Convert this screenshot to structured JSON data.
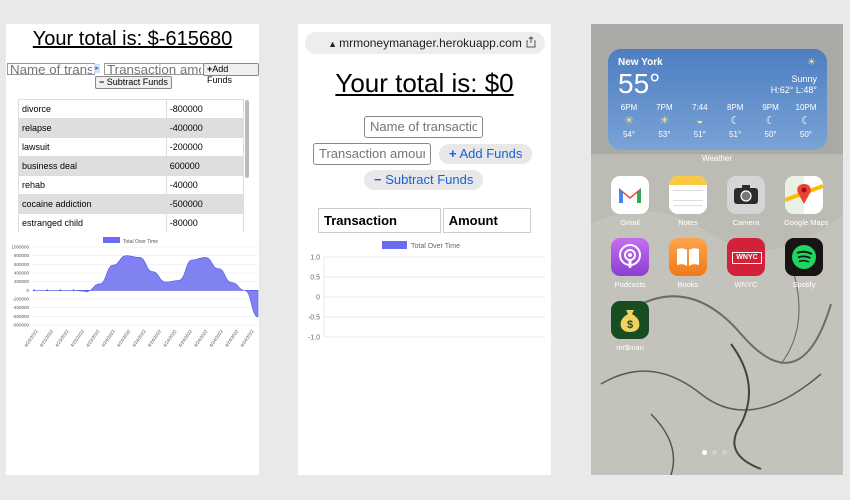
{
  "panel1": {
    "total": "Your total is: $-615680",
    "name_placeholder": "Name of transaction",
    "amount_placeholder": "Transaction amount",
    "add_label": "Add Funds",
    "subtract_label": "Subtract Funds",
    "transactions": [
      {
        "name": "divorce",
        "amount": "-800000"
      },
      {
        "name": "relapse",
        "amount": "-400000"
      },
      {
        "name": "lawsuit",
        "amount": "-200000"
      },
      {
        "name": "business deal",
        "amount": "600000"
      },
      {
        "name": "rehab",
        "amount": "-40000"
      },
      {
        "name": "cocaine addiction",
        "amount": "-500000"
      },
      {
        "name": "estranged child",
        "amount": "-80000"
      }
    ]
  },
  "panel2": {
    "url": "mrmoneymanager.herokuapp.com",
    "total": "Your total is: $0",
    "name_placeholder": "Name of transaction",
    "amount_placeholder": "Transaction amount",
    "add_label": "Add Funds",
    "subtract_label": "Subtract Funds",
    "col_transaction": "Transaction",
    "col_amount": "Amount"
  },
  "chart_data": [
    {
      "type": "area",
      "legend": "Total Over Time",
      "legend_color": "#6a6cf0",
      "x": [
        "4/23/2022",
        "4/23/2022",
        "4/23/2022",
        "4/23/2022",
        "4/23/2022",
        "4/24/2022",
        "4/24/2022",
        "4/24/2022",
        "4/24/2022",
        "4/24/2022",
        "4/24/2022",
        "4/24/2022",
        "4/24/2022",
        "4/24/2022",
        "4/24/2022"
      ],
      "y": [
        0,
        0,
        0,
        0,
        -25000,
        150000,
        580000,
        800000,
        760000,
        430000,
        190000,
        230000,
        700000,
        760000,
        500000,
        180000,
        0,
        -615680
      ],
      "ylim": [
        -800000,
        1000000
      ],
      "yticks": [
        "1000000",
        "800000",
        "600000",
        "400000",
        "200000",
        "0",
        "-200000",
        "-400000",
        "-600000",
        "-800000"
      ]
    },
    {
      "type": "line",
      "legend": "Total Over Time",
      "legend_color": "#6a6cf0",
      "x": [],
      "y": [],
      "ylim": [
        -1.0,
        1.0
      ],
      "yticks": [
        "1.0",
        "0.5",
        "0",
        "-0.5",
        "-1.0"
      ]
    }
  ],
  "phone": {
    "weather": {
      "city": "New York",
      "temp": "55°",
      "condition": "Sunny",
      "hilo": "H:62° L:48°",
      "hours": [
        {
          "time": "6PM",
          "temp": "54°",
          "icon": "sun-icon"
        },
        {
          "time": "7PM",
          "temp": "53°",
          "icon": "sun-icon"
        },
        {
          "time": "7:44",
          "temp": "51°",
          "icon": "sunset-icon"
        },
        {
          "time": "8PM",
          "temp": "51°",
          "icon": "moon-icon"
        },
        {
          "time": "9PM",
          "temp": "50°",
          "icon": "moon-icon"
        },
        {
          "time": "10PM",
          "temp": "50°",
          "icon": "moon-icon"
        }
      ],
      "widget_label": "Weather"
    },
    "apps": [
      {
        "name": "Gmail",
        "icon": "gmail-icon"
      },
      {
        "name": "Notes",
        "icon": "notes-icon"
      },
      {
        "name": "Camera",
        "icon": "camera-icon"
      },
      {
        "name": "Google Maps",
        "icon": "google-maps-icon"
      },
      {
        "name": "Podcasts",
        "icon": "podcasts-icon"
      },
      {
        "name": "Books",
        "icon": "books-icon"
      },
      {
        "name": "WNYC",
        "icon": "wnyc-icon"
      },
      {
        "name": "Spotify",
        "icon": "spotify-icon"
      },
      {
        "name": "mr$man",
        "icon": "money-bag-icon"
      }
    ],
    "wnyc_text": "WNYC"
  }
}
